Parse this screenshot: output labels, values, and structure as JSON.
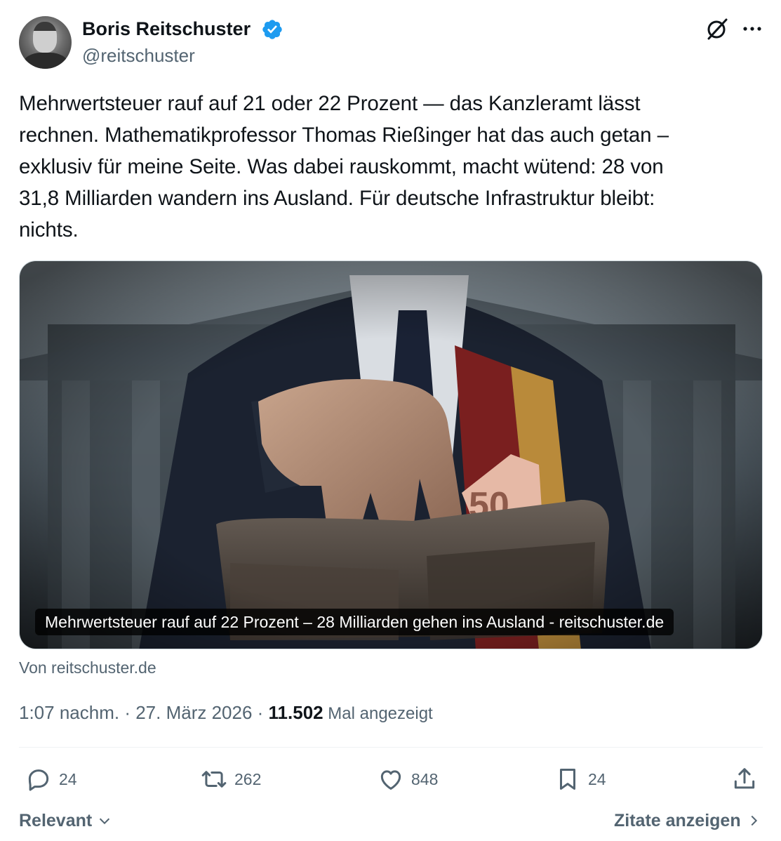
{
  "author": {
    "name": "Boris Reitschuster",
    "handle": "@reitschuster"
  },
  "tweet": {
    "text": "Mehrwertsteuer rauf auf 21 oder 22 Prozent — das Kanzleramt lässt\nrechnen. Mathematikprofessor Thomas Rießinger hat das auch getan –\nexklusiv für meine Seite. Was dabei rauskommt, macht wütend: 28 von\n31,8 Milliarden wandern ins Ausland. Für deutsche Infrastruktur bleibt:\nnichts."
  },
  "card": {
    "caption": "Mehrwertsteuer rauf auf 22 Prozent – 28 Milliarden gehen ins Ausland - reitschuster.de",
    "source": "Von reitschuster.de",
    "banknote_label": "50"
  },
  "meta": {
    "time": "1:07 nachm.",
    "sep1": " · ",
    "date": "27. März 2026",
    "sep2": " · ",
    "views": "11.502",
    "views_label": " Mal angezeigt"
  },
  "actions": {
    "replies": "24",
    "reposts": "262",
    "likes": "848",
    "bookmarks": "24"
  },
  "footer": {
    "sort_label": "Relevant",
    "quotes_label": "Zitate anzeigen"
  },
  "icons": [
    "verified-badge-icon",
    "grok-icon",
    "more-icon",
    "reply-icon",
    "repost-icon",
    "like-icon",
    "bookmark-icon",
    "share-icon",
    "chevron-down-icon",
    "chevron-right-icon"
  ],
  "colors": {
    "text": "#0f1419",
    "secondary": "#536471",
    "verified": "#1d9bf0"
  }
}
